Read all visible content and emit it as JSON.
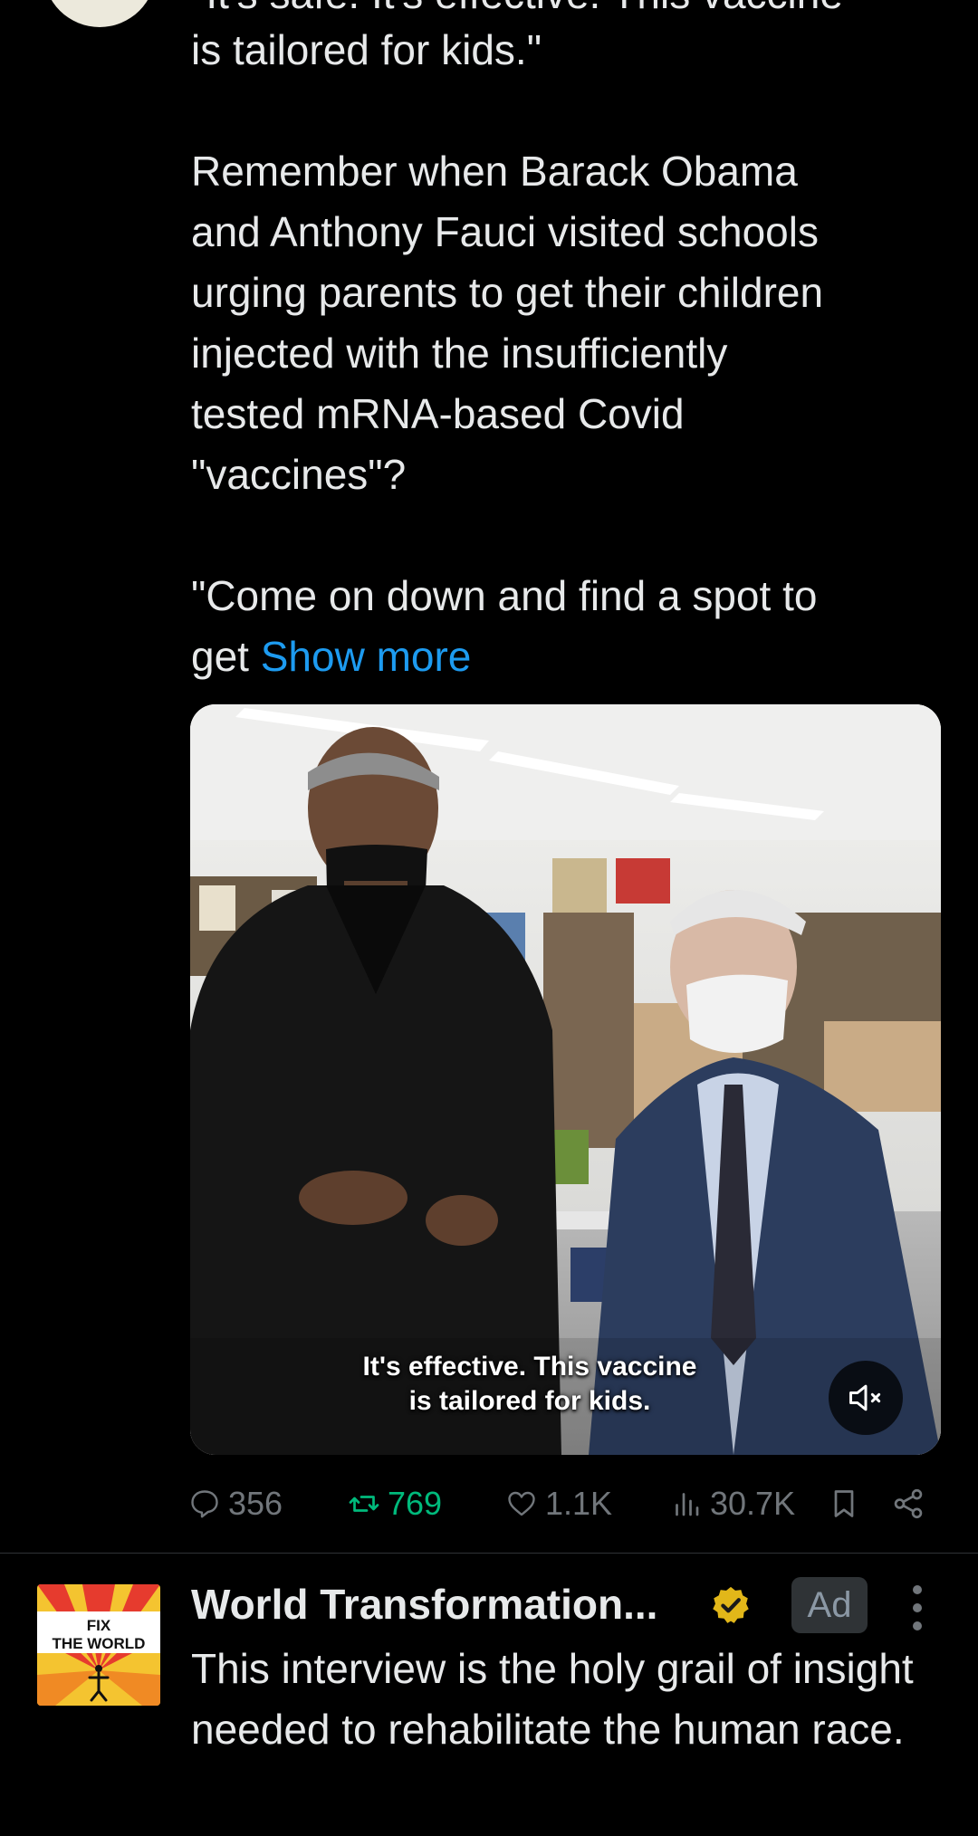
{
  "tweet": {
    "cut_line": "\"It's safe. It's effective. This vaccine",
    "text_line_1": "is tailored for kids.\"",
    "paragraph_2": "Remember when Barack Obama\nand Anthony Fauci visited schools\nurging parents to get their children\ninjected with the insufficiently\ntested mRNA-based Covid\n\"vaccines\"?",
    "paragraph_3_start": "\"Come on down and find a spot to\nget ",
    "show_more": "Show more",
    "media": {
      "caption_line_1": "It's effective. This vaccine",
      "caption_line_2": "is tailored for kids.",
      "mute_icon": "speaker-muted-icon"
    },
    "actions": {
      "replies": "356",
      "reposts": "769",
      "likes": "1.1K",
      "views": "30.7K",
      "bookmark_icon": "bookmark-icon",
      "share_icon": "share-icon"
    }
  },
  "ad": {
    "name": "World Transformation...",
    "badge": "Ad",
    "avatar_text_1": "FIX",
    "avatar_text_2": "THE WORLD",
    "text": "This interview is the holy grail of insight needed to rehabilitate the human race."
  },
  "colors": {
    "background": "#000000",
    "text": "#e7e9ea",
    "muted": "#71767b",
    "link": "#1d9bf0",
    "repost_green": "#00ba7c",
    "verified_gold": "#e2b719"
  }
}
